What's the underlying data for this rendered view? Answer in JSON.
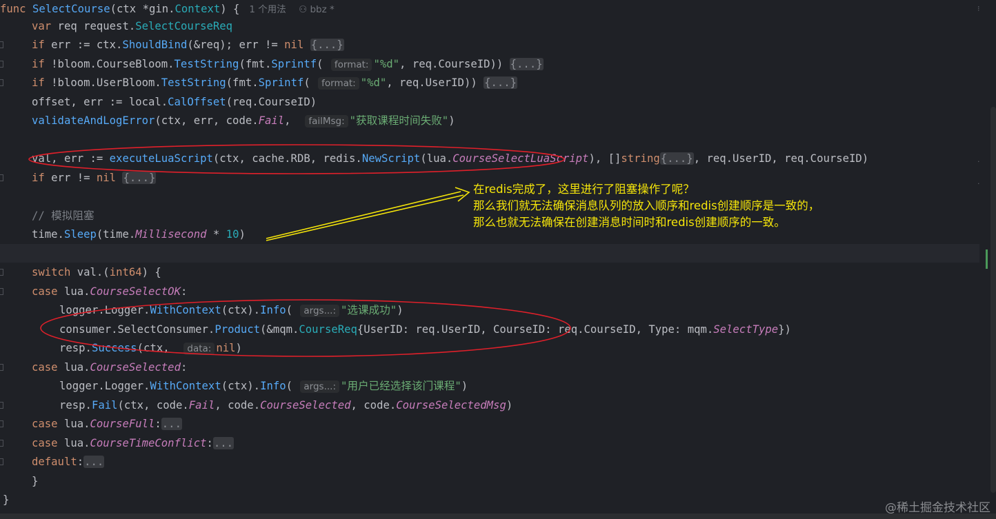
{
  "usage_hint": {
    "count": "1 个用法",
    "author": "bbz *"
  },
  "code": {
    "l1": {
      "kw": "func",
      "name": "SelectCourse",
      "rest": "(ctx *gin.",
      "type": "Context",
      ") {": ") {"
    },
    "hints": {
      "format": "format:",
      "failMsg": "failMsg:",
      "args": "args...:",
      "data": "data:"
    },
    "fold_placeholder": "{...}",
    "ellipsis": "...",
    "strings": {
      "fmt_d": "\"%d\"",
      "get_time_fail": "\"获取课程时间失败\"",
      "select_ok": "\"选课成功\"",
      "already_selected": "\"用户已经选择该门课程\""
    },
    "comment": "// 模拟阻塞",
    "number": "10"
  },
  "annotation": {
    "line1": "在redis完成了，这里进行了阻塞操作了呢？",
    "line2": "那么我们就无法确保消息队列的放入顺序和redis创建顺序是一致的，",
    "line3": "那么也就无法确保在创建消息时间时和redis创建顺序的一致。"
  },
  "watermark": "@稀土掘金技术社区",
  "colors": {
    "annotation": "#f5e50a",
    "ellipse": "#e0202a",
    "arrow": "#f5e50a",
    "background": "#1f2126"
  }
}
